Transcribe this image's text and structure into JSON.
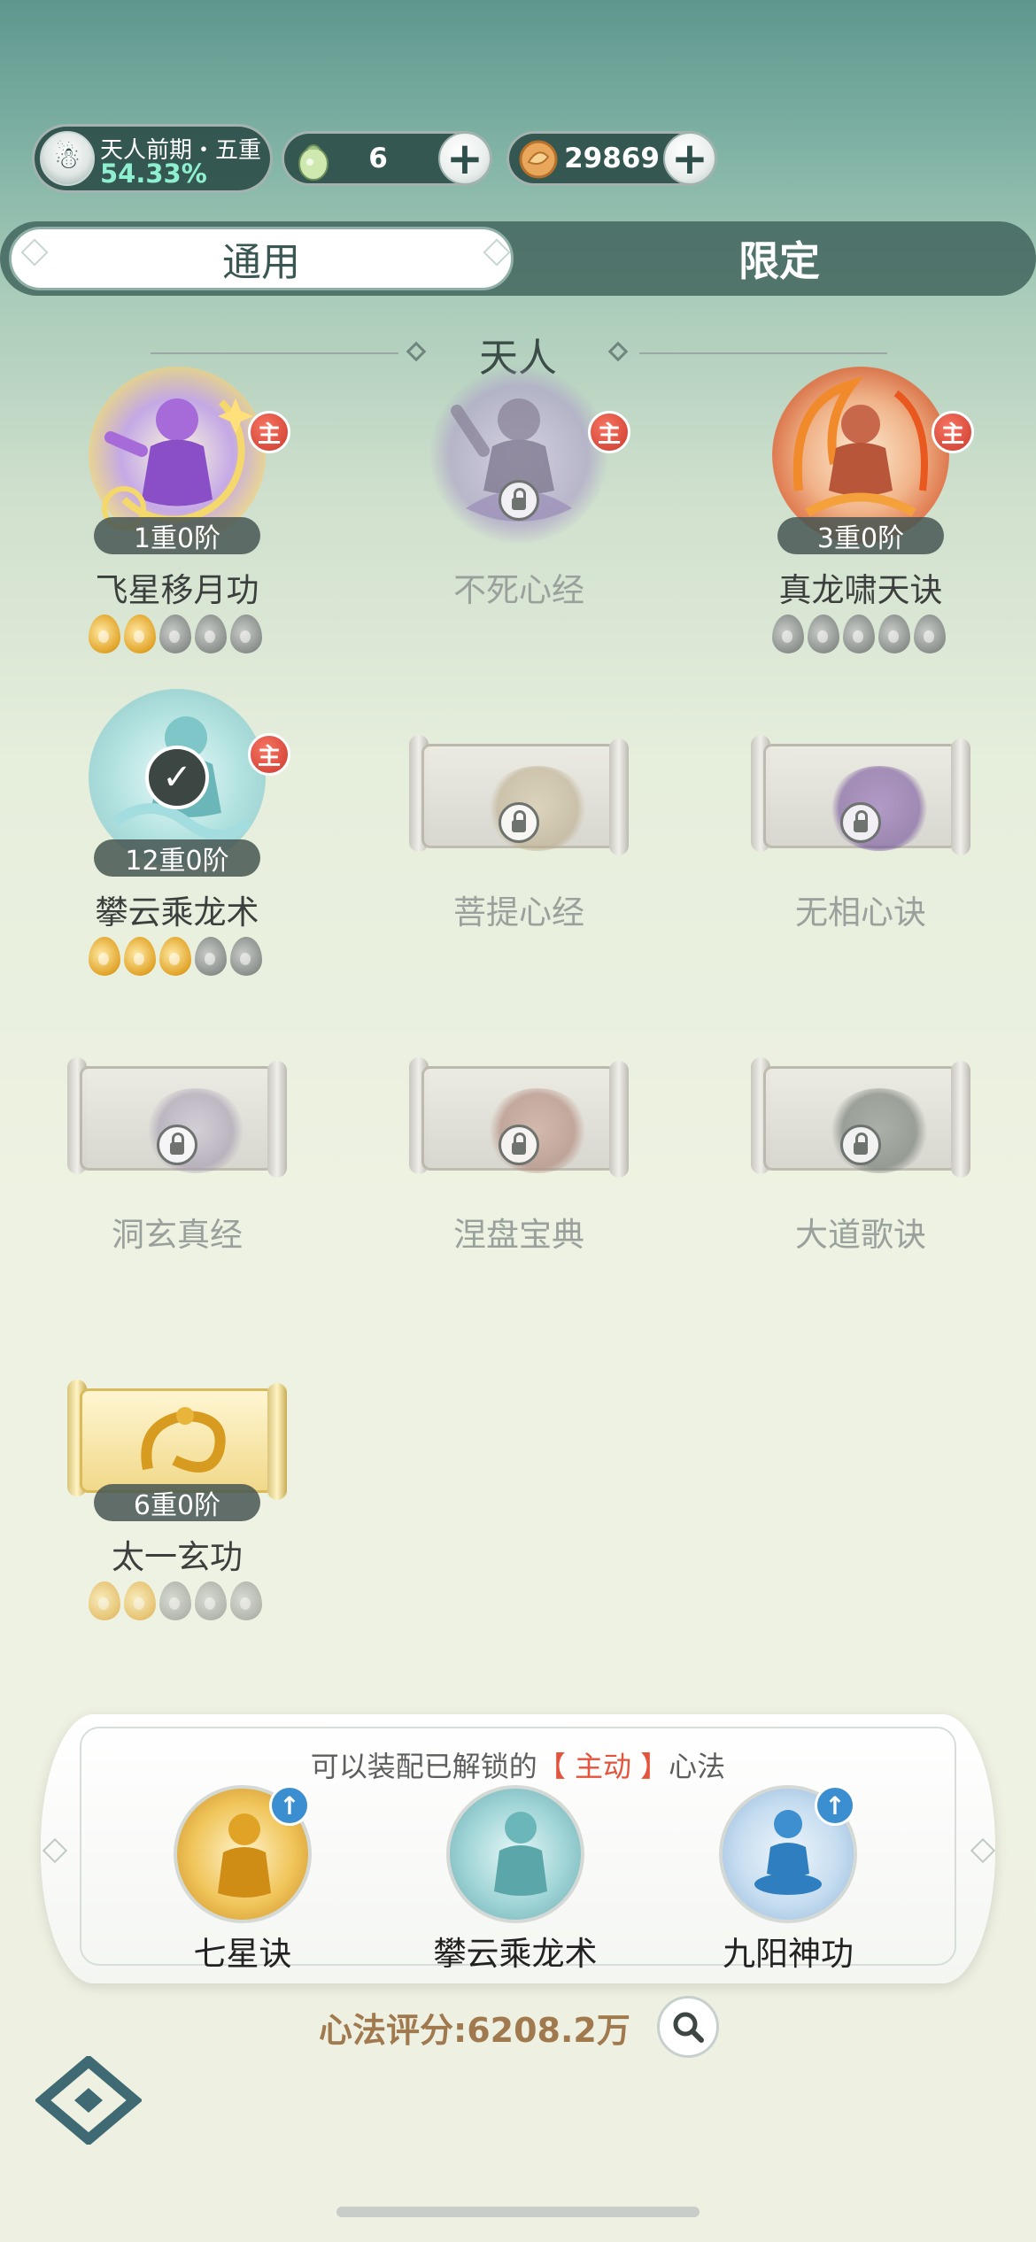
{
  "header": {
    "rank_title": "天人前期・五重",
    "rank_progress": "54.33%",
    "resource_1": {
      "icon": "herb-pouch-icon",
      "value": "6"
    },
    "resource_2": {
      "icon": "copper-coin-icon",
      "value": "29869"
    }
  },
  "tabs": [
    {
      "label": "通用",
      "active": true
    },
    {
      "label": "限定",
      "active": false
    }
  ],
  "section": {
    "title": "天人"
  },
  "skills": [
    {
      "name": "飞星移月功",
      "level": "1重0阶",
      "main": true,
      "badge": "主",
      "locked": false,
      "stars_filled": 2,
      "stars_total": 5
    },
    {
      "name": "不死心经",
      "level": "",
      "main": true,
      "badge": "主",
      "locked": true
    },
    {
      "name": "真龙啸天诀",
      "level": "3重0阶",
      "main": true,
      "badge": "主",
      "locked": false,
      "stars_filled": 0,
      "stars_total": 5
    },
    {
      "name": "攀云乘龙术",
      "level": "12重0阶",
      "main": true,
      "badge": "主",
      "locked": false,
      "equipped": true,
      "stars_filled": 3,
      "stars_total": 5
    },
    {
      "name": "菩提心经",
      "level": "",
      "locked": true
    },
    {
      "name": "无相心诀",
      "level": "",
      "locked": true
    },
    {
      "name": "洞玄真经",
      "level": "",
      "locked": true
    },
    {
      "name": "涅盘宝典",
      "level": "",
      "locked": true
    },
    {
      "name": "大道歌诀",
      "level": "",
      "locked": true
    },
    {
      "name": "太一玄功",
      "level": "6重0阶",
      "locked": false,
      "stars_filled": 2,
      "stars_total": 5
    }
  ],
  "equip_panel": {
    "hint_prefix": "可以装配已解锁的",
    "hint_key": "【 主动 】",
    "hint_suffix": "心法",
    "slots": [
      {
        "name": "七星诀",
        "upgrade": true
      },
      {
        "name": "攀云乘龙术",
        "upgrade": false
      },
      {
        "name": "九阳神功",
        "upgrade": true
      }
    ]
  },
  "score": {
    "label": "心法评分:6208.2万"
  },
  "colors": {
    "accent_red": "#e4533c",
    "score_gold": "#a07a4e",
    "tab_bar": "#3e625a"
  }
}
